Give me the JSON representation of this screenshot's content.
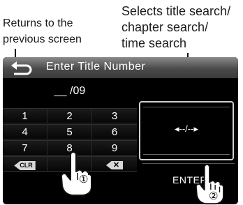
{
  "callouts": {
    "back_line1": "Returns to the",
    "back_line2": "previous screen",
    "search_line1": "Selects title search/",
    "search_line2": "chapter search/",
    "search_line3": "time search"
  },
  "screen": {
    "title": "Enter Title Number",
    "entry_value": "__ /09"
  },
  "keypad": {
    "rows": [
      [
        "1",
        "2",
        "3"
      ],
      [
        "4",
        "5",
        "6"
      ],
      [
        "7",
        "8",
        "9"
      ]
    ],
    "clear_label": "CLR",
    "delete_label": "✕"
  },
  "search_button": {
    "label": "◂--/--▸"
  },
  "enter_button": {
    "label": "ENTER"
  },
  "markers": {
    "one": "①",
    "two": "②"
  },
  "colors": {
    "screen_bg": "#000000",
    "text": "#ffffff",
    "titlebar": "#5a5a5a"
  },
  "icons": [
    "back-arrow-icon",
    "clear-icon",
    "delete-icon",
    "pointing-hand-icon"
  ]
}
